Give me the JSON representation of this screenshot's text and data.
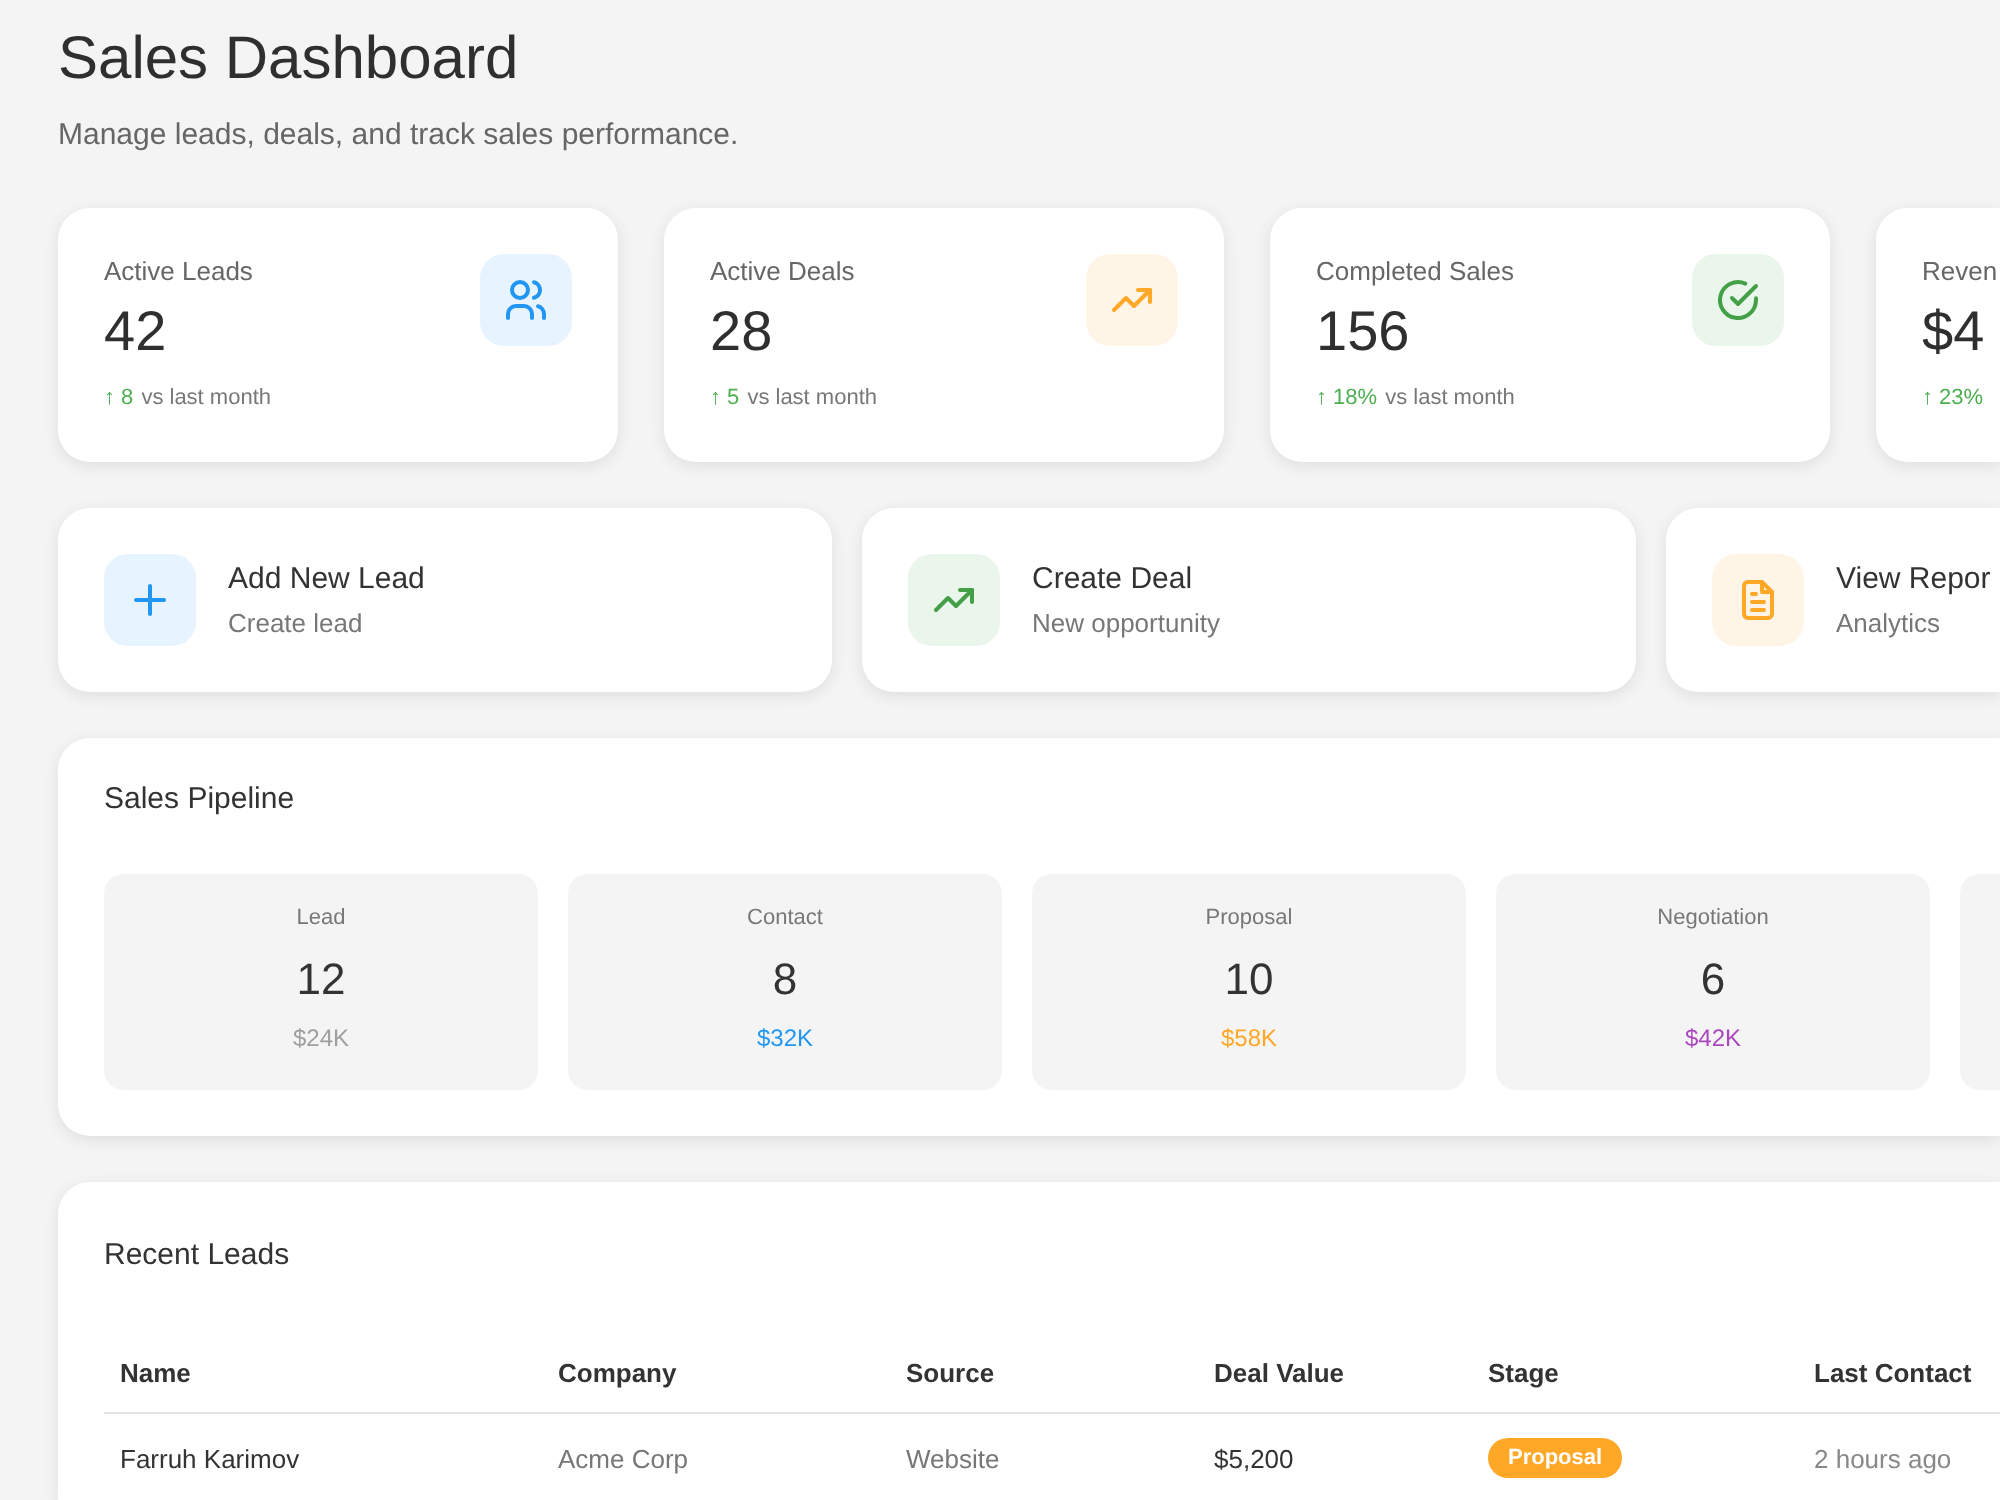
{
  "header": {
    "title": "Sales Dashboard",
    "subtitle": "Manage leads, deals, and track sales performance."
  },
  "stats": [
    {
      "label": "Active Leads",
      "value": "42",
      "change": "↑ 8",
      "note": "vs last month",
      "color": "#2196f3"
    },
    {
      "label": "Active Deals",
      "value": "28",
      "change": "↑ 5",
      "note": "vs last month",
      "color": "#ffa726"
    },
    {
      "label": "Completed Sales",
      "value": "156",
      "change": "↑ 18%",
      "note": "vs last month",
      "color": "#43a047"
    },
    {
      "label": "Reven",
      "value": "$4",
      "change": "↑ 23%"
    }
  ],
  "actions": [
    {
      "title": "Add New Lead",
      "subtitle": "Create lead",
      "color": "#2196f3"
    },
    {
      "title": "Create Deal",
      "subtitle": "New opportunity",
      "color": "#43a047"
    },
    {
      "title": "View Repor",
      "subtitle": "Analytics",
      "color": "#ffa726"
    }
  ],
  "pipeline": {
    "title": "Sales Pipeline",
    "stages": [
      {
        "name": "Lead",
        "count": "12",
        "value": "$24K",
        "color": "#9e9e9e"
      },
      {
        "name": "Contact",
        "count": "8",
        "value": "$32K",
        "color": "#2196f3"
      },
      {
        "name": "Proposal",
        "count": "10",
        "value": "$58K",
        "color": "#ffa726"
      },
      {
        "name": "Negotiation",
        "count": "6",
        "value": "$42K",
        "color": "#ab47bc"
      }
    ]
  },
  "recent_leads": {
    "title": "Recent Leads",
    "columns": [
      "Name",
      "Company",
      "Source",
      "Deal Value",
      "Stage",
      "Last Contact"
    ],
    "rows": [
      {
        "name": "Farruh Karimov",
        "company": "Acme Corp",
        "source": "Website",
        "deal_value": "$5,200",
        "stage": {
          "label": "Proposal",
          "color": "#ffa726"
        },
        "last_contact": "2 hours ago"
      }
    ]
  }
}
